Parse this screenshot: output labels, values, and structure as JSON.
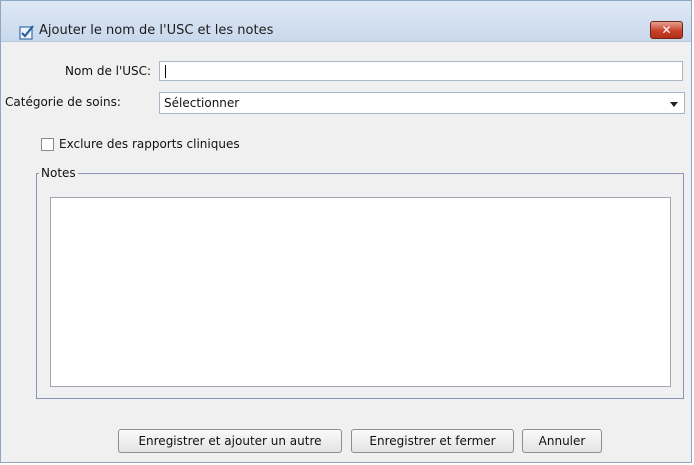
{
  "window": {
    "title": "Ajouter le nom de l'USC et les notes",
    "close_symbol": "✕",
    "title_icon": "checkbox-edit-icon"
  },
  "form": {
    "usc_name_label": "Nom de l'USC:",
    "usc_name_value": "",
    "care_category_label": "Catégorie de soins:",
    "care_category_selected": "Sélectionner",
    "exclude_label": "Exclure des rapports cliniques",
    "exclude_checked": false,
    "notes_legend": "Notes",
    "notes_value": ""
  },
  "buttons": {
    "save_add": "Enregistrer et ajouter un autre",
    "save_close": "Enregistrer et fermer",
    "cancel": "Annuler"
  },
  "colors": {
    "titlebar": "#c9d8ec",
    "close_button": "#c8412a",
    "fieldset_border": "#8c93b8"
  }
}
